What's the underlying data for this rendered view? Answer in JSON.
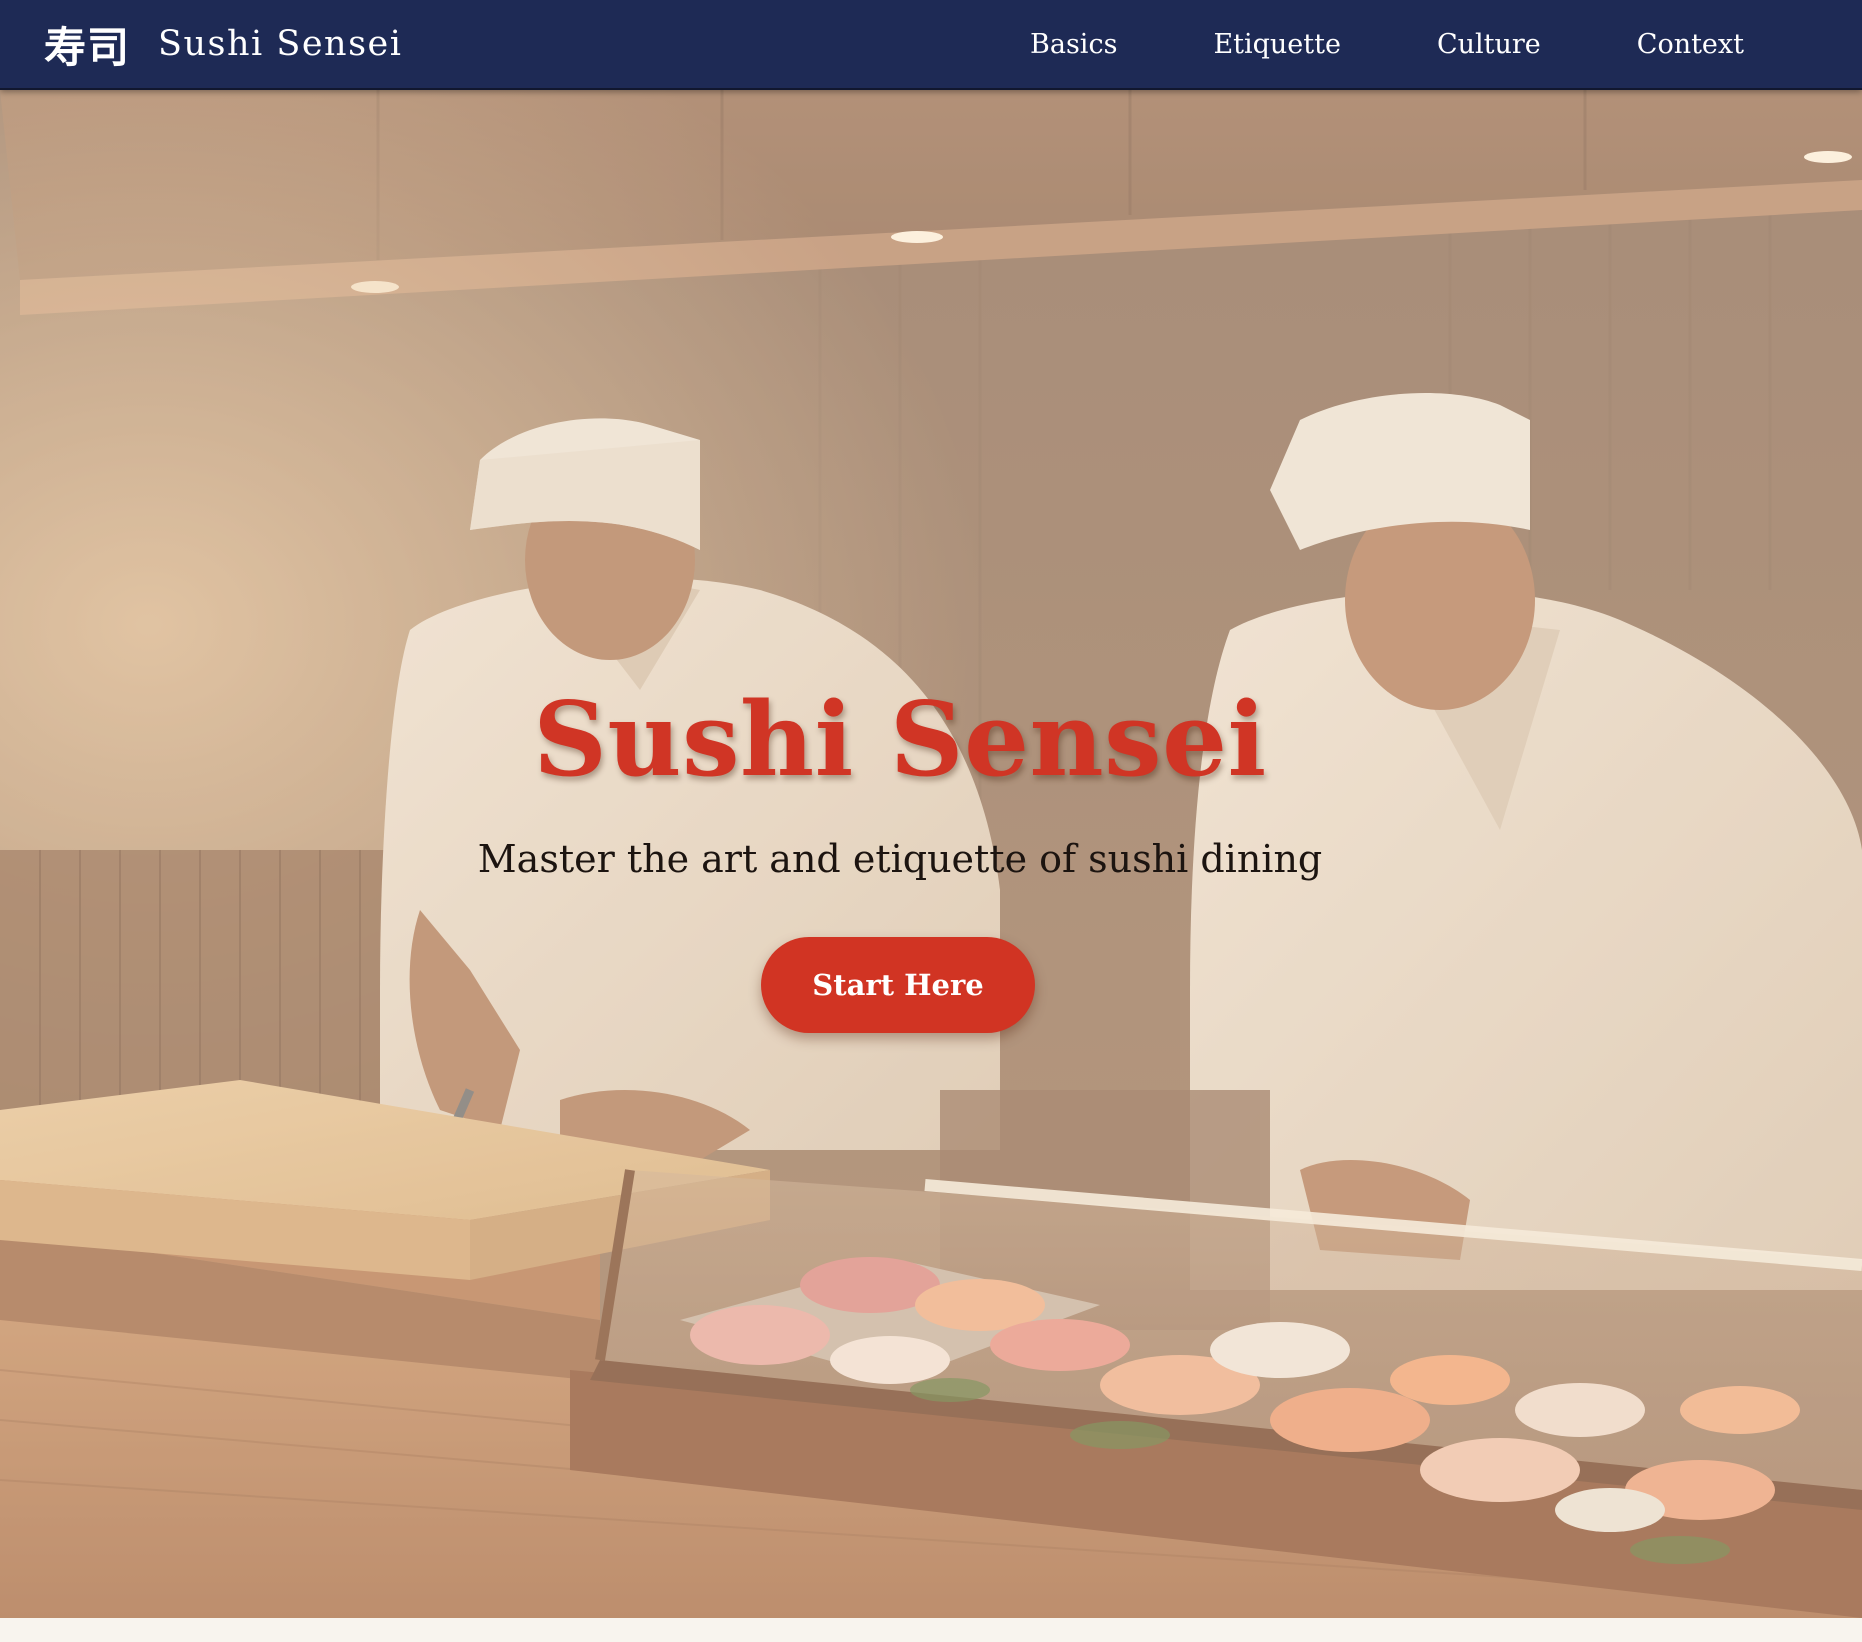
{
  "navbar": {
    "brand_kanji": "寿司",
    "brand_name": "Sushi Sensei",
    "links": [
      {
        "label": "Basics"
      },
      {
        "label": "Etiquette"
      },
      {
        "label": "Culture"
      },
      {
        "label": "Context"
      }
    ],
    "background_color": "#1e2a55"
  },
  "hero": {
    "title": "Sushi Sensei",
    "subtitle": "Master the art and etiquette of sushi dining",
    "cta_label": "Start Here",
    "accent_color": "#d13423",
    "background_image": "two sushi chefs preparing sushi at a wooden counter with a glass display case of nigiri"
  }
}
